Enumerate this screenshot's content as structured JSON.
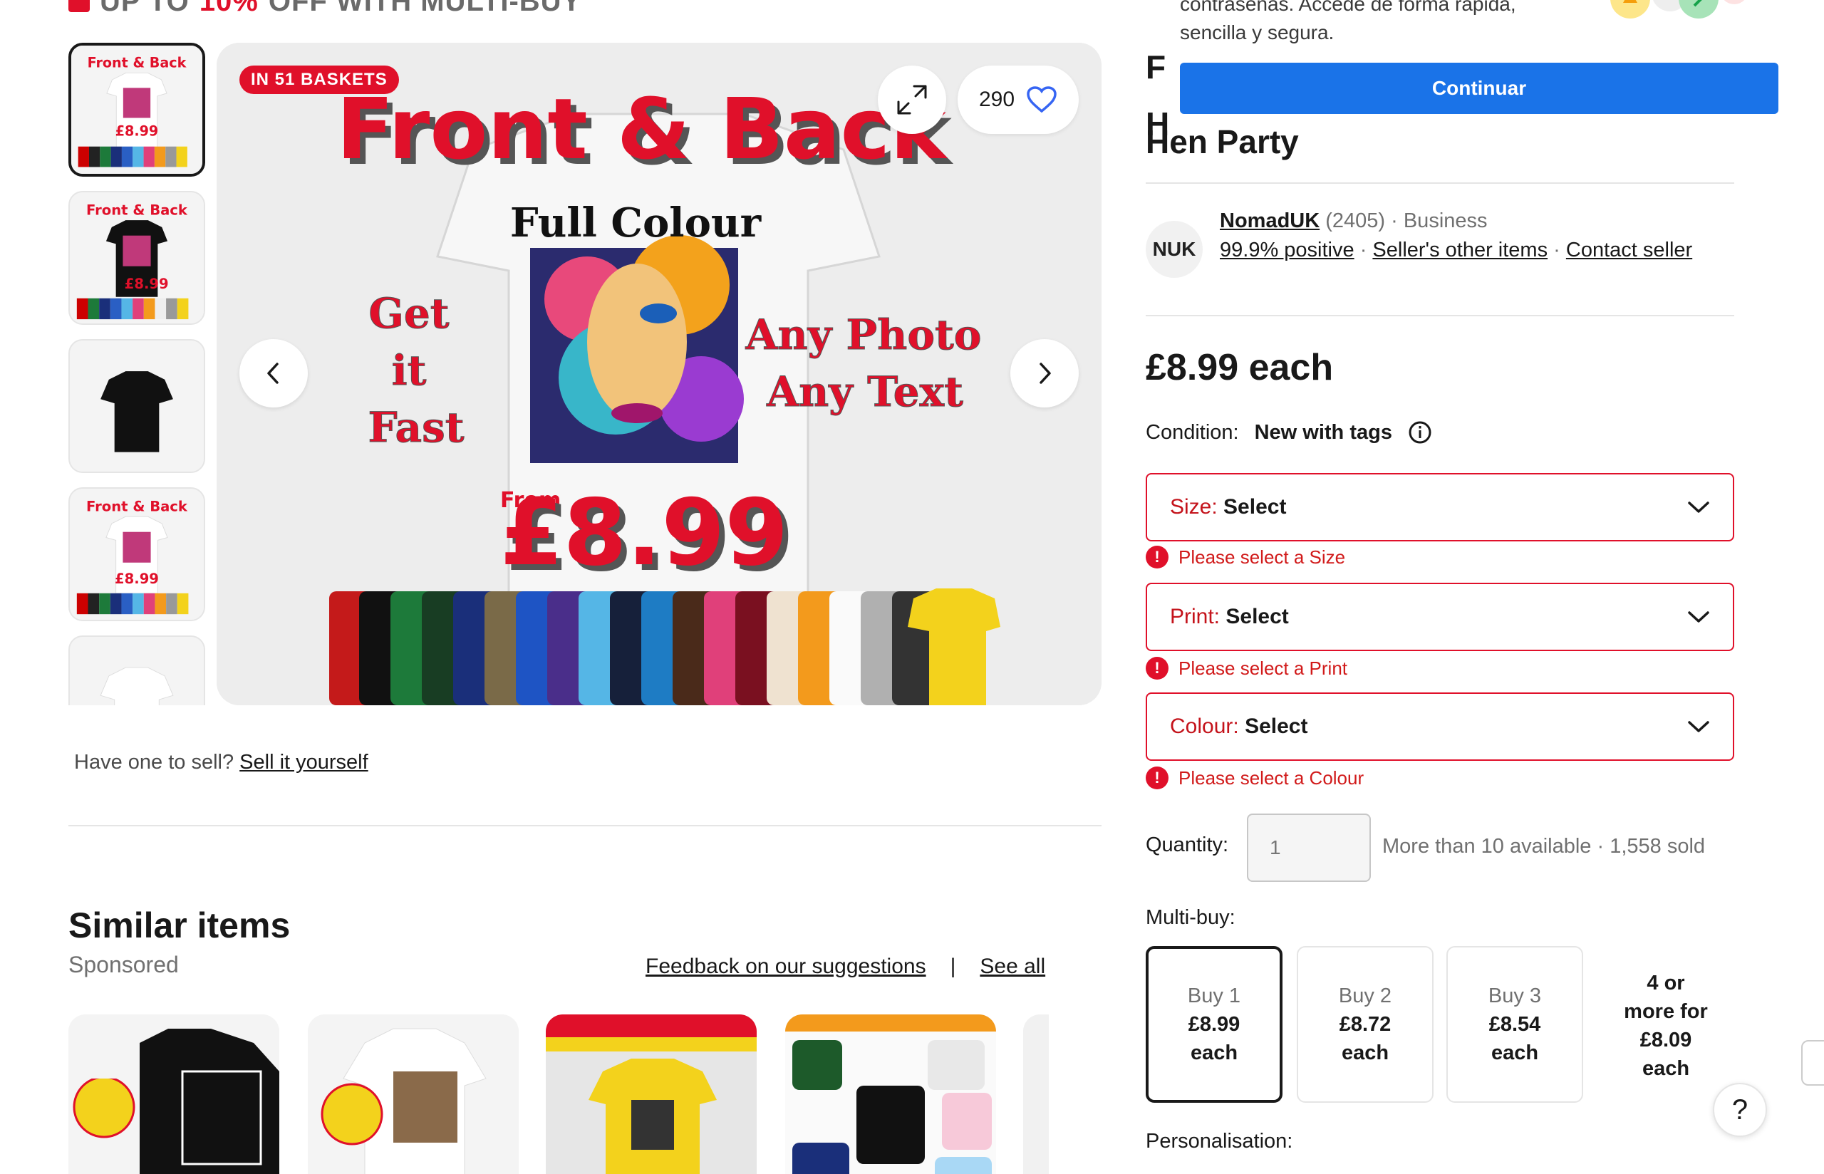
{
  "promo": {
    "prefix": "UP TO",
    "percent": "10%",
    "suffix": "OFF WITH MULTI-BUY"
  },
  "gallery": {
    "badge": "IN 51 BASKETS",
    "watch_count": "290",
    "art": {
      "headline": "Front & Back",
      "full_colour": "Full Colour",
      "get": "Get",
      "it": "it",
      "fast": "Fast",
      "any_photo": "Any Photo",
      "any_text": "Any Text",
      "from": "From",
      "price": "£8.99"
    },
    "thumb_text": {
      "headline": "Front & Back",
      "price": "£8.99"
    }
  },
  "sell": {
    "question": "Have one to sell?",
    "link": "Sell it yourself"
  },
  "similar": {
    "title": "Similar items",
    "sponsored": "Sponsored",
    "feedback_link": "Feedback on our suggestions",
    "separator": "|",
    "see_all": "See all"
  },
  "popup": {
    "text_line1": "contraseñas. Accede de forma rápida,",
    "text_line2": "sencilla y segura.",
    "button": "Continuar"
  },
  "title": {
    "frag1": "F",
    "frag2": "H",
    "line3": "Hen Party"
  },
  "seller": {
    "logo": "NUK",
    "name": "NomadUK",
    "count": "(2405)",
    "type": "Business",
    "positive": "99.9% positive",
    "other_items": "Seller's other items",
    "contact": "Contact seller"
  },
  "price": "£8.99 each",
  "condition": {
    "label": "Condition:",
    "value": "New with tags"
  },
  "selects": [
    {
      "label": "Size:",
      "value": "Select",
      "error": "Please select a Size"
    },
    {
      "label": "Print:",
      "value": "Select",
      "error": "Please select a Print"
    },
    {
      "label": "Colour:",
      "value": "Select",
      "error": "Please select a Colour"
    }
  ],
  "quantity": {
    "label": "Quantity:",
    "placeholder": "1",
    "info": "More than 10 available",
    "sold": "1,558 sold"
  },
  "multibuy": {
    "label": "Multi-buy:",
    "options": [
      {
        "buy": "Buy 1",
        "price": "£8.99",
        "each": "each"
      },
      {
        "buy": "Buy 2",
        "price": "£8.72",
        "each": "each"
      },
      {
        "buy": "Buy 3",
        "price": "£8.54",
        "each": "each"
      }
    ],
    "more_line1": "4 or",
    "more_line2": "more for",
    "more_line3": "£8.09",
    "more_line4": "each"
  },
  "personalisation": "Personalisation:",
  "help": "?",
  "colors": {
    "accent": "#1a73e8",
    "error": "#e0102a",
    "text": "#191919"
  }
}
